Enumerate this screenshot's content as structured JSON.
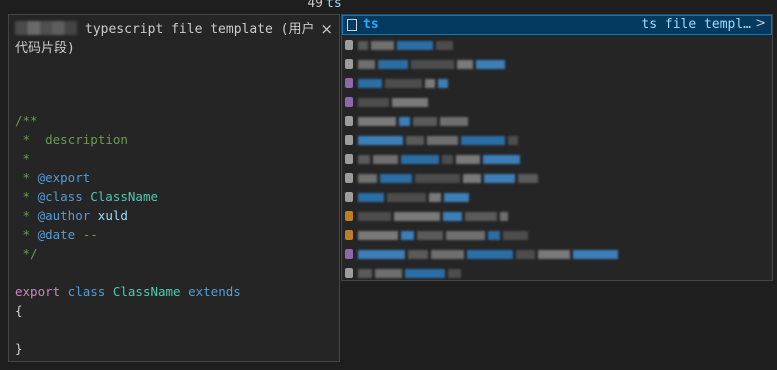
{
  "editor": {
    "line_number": "49",
    "line_text": "ts"
  },
  "details": {
    "title": "typescript file template (用户代码片段)",
    "close_glyph": "×",
    "code": {
      "l1": "/**",
      "l2_star": " *",
      "l2_text": "  description",
      "l3": " *",
      "l4_star": " * ",
      "l4_tag": "@export",
      "l5_star": " * ",
      "l5_tag": "@class",
      "l5_name": " ClassName",
      "l6_star": " * ",
      "l6_tag": "@author",
      "l6_name": " xuld",
      "l7_star": " * ",
      "l7_tag": "@date",
      "l7_rest": " --",
      "l8": " */",
      "l9_kw": "export",
      "l9_kw2": " class",
      "l9_type": " ClassName",
      "l9_ext": " extends",
      "l10": "{",
      "l11": "}"
    }
  },
  "suggest": {
    "selected": {
      "label": "ts",
      "detail": "ts file templ…",
      "arrow": ">"
    }
  }
}
